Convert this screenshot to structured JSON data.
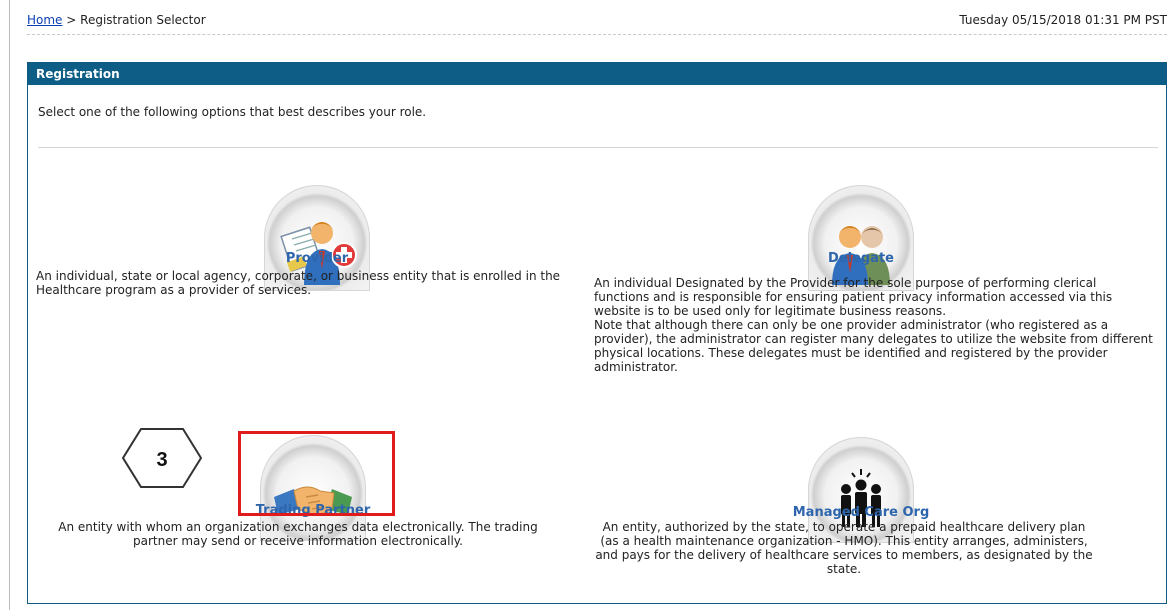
{
  "breadcrumb": {
    "home": "Home",
    "separator": ">",
    "current": "Registration Selector"
  },
  "timestamp": "Tuesday 05/15/2018 01:31 PM PST",
  "panel": {
    "title": "Registration",
    "intro": "Select one of the following options that best describes your role."
  },
  "roles": [
    {
      "label": "Provider",
      "desc": "An individual, state or local agency, corporate, or business entity that is enrolled in the Healthcare program as a provider of services."
    },
    {
      "label": "Delegate",
      "desc": "An individual Designated by the Provider for the sole purpose of performing clerical functions and is responsible for ensuring patient privacy information accessed via this website is to be used only for legitimate business reasons.\nNote that although there can only be one provider administrator (who registered as a provider), the administrator can register many delegates to utilize the website from different physical locations. These delegates must be identified and registered by the provider administrator."
    },
    {
      "label": "Trading Partner",
      "desc": "An entity with whom an organization exchanges data electronically. The trading partner may send or receive information electronically."
    },
    {
      "label": "Managed Care Org",
      "desc": "An entity, authorized by the state, to operate a prepaid healthcare delivery plan (as a health maintenance organization - HMO). This entity arranges, administers, and pays for the delivery of healthcare services to members, as designated by the state."
    }
  ],
  "step_marker": "3",
  "colors": {
    "header": "#0d5d87",
    "label": "#2e66ad",
    "highlight": "#e01b1b",
    "link": "#0b3fb4"
  }
}
